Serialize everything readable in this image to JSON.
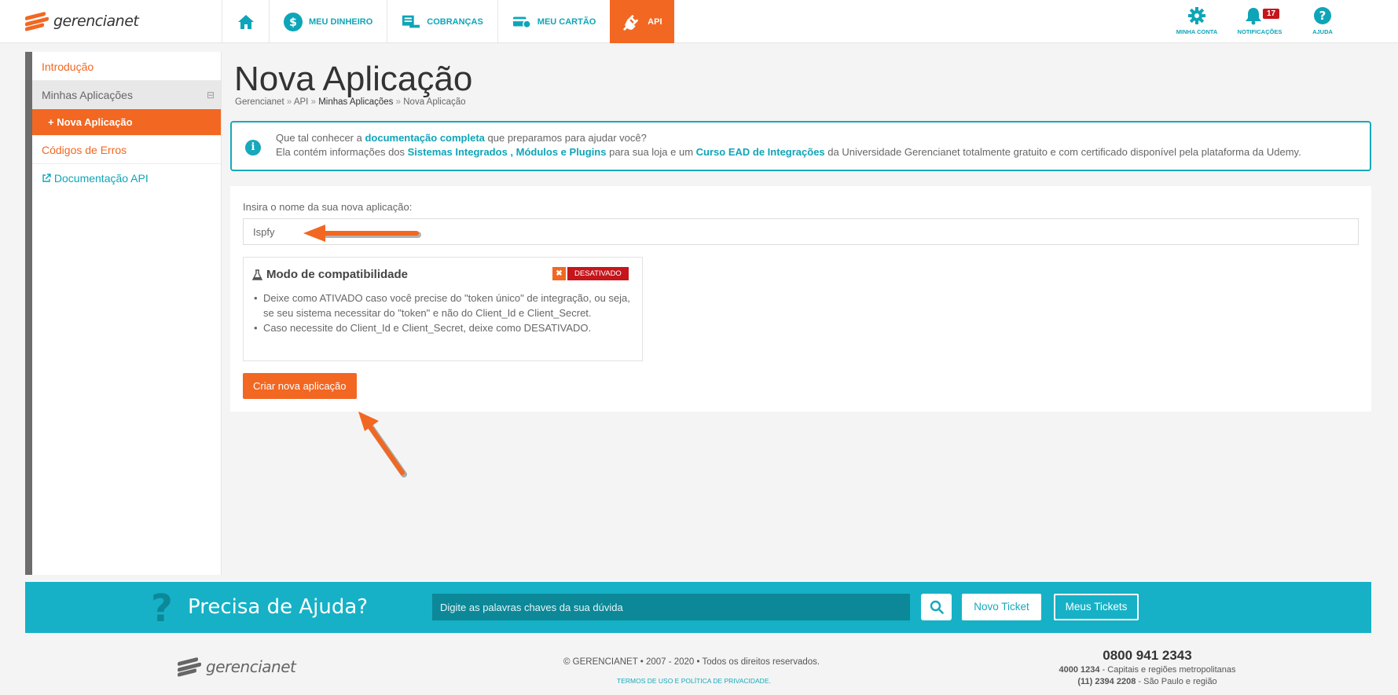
{
  "brand": {
    "name": "gerencianet",
    "accent": "#f26722",
    "teal": "#16b1c6"
  },
  "nav": {
    "home_icon": "home-icon",
    "items": [
      {
        "label": "MEU DINHEIRO",
        "icon": "dollar-coin-icon"
      },
      {
        "label": "COBRANÇAS",
        "icon": "invoice-icon"
      },
      {
        "label": "MEU CARTÃO",
        "icon": "card-icon"
      },
      {
        "label": "API",
        "icon": "plug-icon"
      }
    ]
  },
  "right_nav": {
    "account": "MINHA CONTA",
    "notifications": "NOTIFICAÇÕES",
    "notifications_count": "17",
    "help": "AJUDA"
  },
  "sidebar": {
    "intro": "Introdução",
    "my_apps": "Minhas Aplicações",
    "collapse": "⊟",
    "new_app": "+ Nova Aplicação",
    "error_codes": "Códigos de Erros",
    "api_docs": "Documentação API"
  },
  "page": {
    "title": "Nova Aplicação",
    "breadcrumb": [
      "Gerencianet",
      "API",
      "Minhas Aplicações",
      "Nova Aplicação"
    ],
    "breadcrumb_sep": "»"
  },
  "info": {
    "line1_pre": "Que tal conhecer a ",
    "line1_link": "documentação completa",
    "line1_post": " que preparamos para ajudar você?",
    "line2_a": "Ela contém informações dos ",
    "line2_link1": "Sistemas Integrados",
    "line2_b": " , ",
    "line2_link2": "Módulos e Plugins",
    "line2_c": " para sua loja e um ",
    "line2_link3": "Curso EAD de Integrações",
    "line2_d": " da Universidade Gerencianet totalmente gratuito e com certificado disponível pela plataforma da Udemy."
  },
  "form": {
    "name_label": "Insira o nome da sua nova aplicação:",
    "name_value": "Ispfy",
    "compat_title": "Modo de compatibilidade",
    "compat_status": "DESATIVADO",
    "compat_status_icon": "✖",
    "compat_bullets": [
      "Deixe como ATIVADO caso você precise do \"token único\" de integração, ou seja, se seu sistema necessitar do \"token\" e não do Client_Id e Client_Secret.",
      "Caso necessite do Client_Id e Client_Secret, deixe como DESATIVADO."
    ],
    "submit": "Criar nova aplicação"
  },
  "help": {
    "title": "Precisa de Ajuda?",
    "search_placeholder": "Digite as palavras chaves da sua dúvida",
    "new_ticket": "Novo Ticket",
    "my_tickets": "Meus Tickets"
  },
  "footer": {
    "copyright": "© GERENCIANET • 2007 - 2020 • Todos os direitos reservados.",
    "terms": "TERMOS DE USO E POLÍTICA DE PRIVACIDADE.",
    "phone_main": "0800 941 2343",
    "phone2_num": "4000 1234",
    "phone2_desc": " - Capitais e regiões metropolitanas",
    "phone3_num": "(11) 2394 2208",
    "phone3_desc": " - São Paulo e região"
  }
}
